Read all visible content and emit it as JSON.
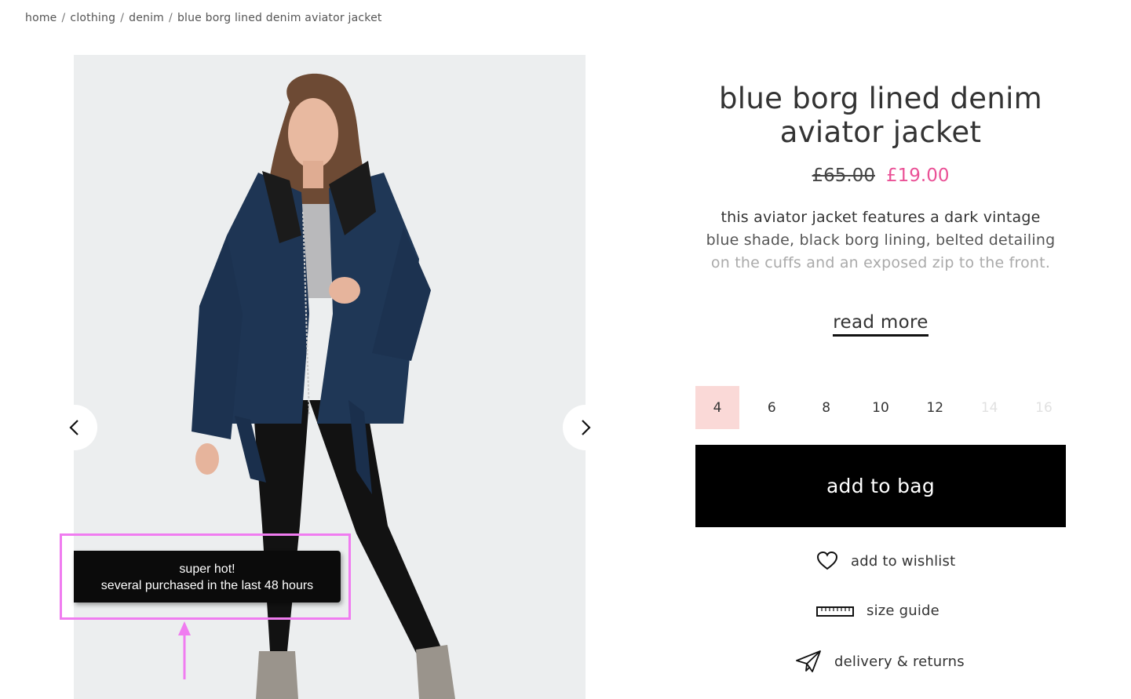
{
  "breadcrumb": {
    "items": [
      "home",
      "clothing",
      "denim",
      "blue borg lined denim aviator jacket"
    ],
    "separator": "/"
  },
  "gallery": {
    "prev_icon": "chevron-left-icon",
    "next_icon": "chevron-right-icon"
  },
  "badge": {
    "line1": "super hot!",
    "line2": "several purchased in the last 48 hours",
    "highlight_color": "#f07cf0"
  },
  "product": {
    "title_line1": "blue borg lined denim",
    "title_line2": "aviator jacket",
    "price_old": "£65.00",
    "price_new": "£19.00",
    "description_line1": "this aviator jacket features a dark vintage",
    "description_line2": "blue shade, black borg lining, belted detailing",
    "description_line3": "on the cuffs and an exposed zip to the front.",
    "read_more": "read more"
  },
  "sizes": [
    {
      "label": "4",
      "state": "selected"
    },
    {
      "label": "6",
      "state": "available"
    },
    {
      "label": "8",
      "state": "available"
    },
    {
      "label": "10",
      "state": "available"
    },
    {
      "label": "12",
      "state": "available"
    },
    {
      "label": "14",
      "state": "unavailable"
    },
    {
      "label": "16",
      "state": "unavailable"
    }
  ],
  "actions": {
    "add_to_bag": "add to bag",
    "wishlist": "add to wishlist",
    "size_guide": "size guide",
    "delivery": "delivery & returns"
  },
  "colors": {
    "sale_price": "#ea5196",
    "selected_size_bg": "#fad9d7",
    "button_bg": "#000000"
  }
}
